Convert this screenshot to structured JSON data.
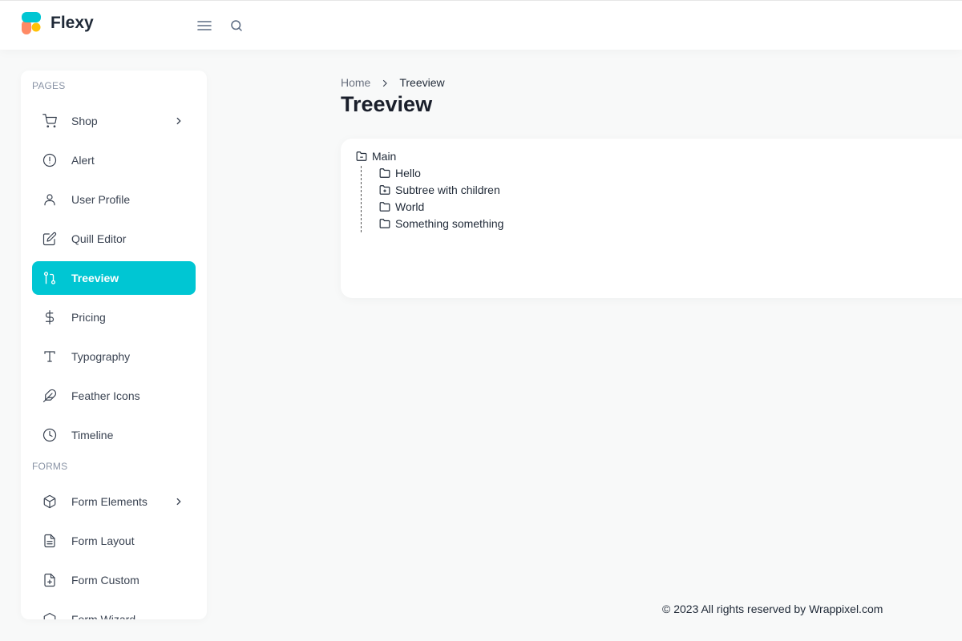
{
  "header": {
    "brand": "Flexy",
    "colors": {
      "logo_teal": "#00c6d3",
      "logo_yellow": "#ffc107",
      "logo_orange": "#ff8a65"
    },
    "menu_icon": "menu-icon",
    "search_icon": "search-icon"
  },
  "sidebar": {
    "sections": [
      {
        "label": "PAGES"
      },
      {
        "label": "FORMS"
      }
    ],
    "items": [
      {
        "label": "Shop",
        "icon": "shopping-cart-icon",
        "has_chevron": true
      },
      {
        "label": "Alert",
        "icon": "alert-circle-icon"
      },
      {
        "label": "User Profile",
        "icon": "user-icon"
      },
      {
        "label": "Quill Editor",
        "icon": "edit-icon"
      },
      {
        "label": "Treeview",
        "icon": "git-pull-request-icon",
        "active": true
      },
      {
        "label": "Pricing",
        "icon": "dollar-sign-icon"
      },
      {
        "label": "Typography",
        "icon": "type-icon"
      },
      {
        "label": "Feather Icons",
        "icon": "feather-icon"
      },
      {
        "label": "Timeline",
        "icon": "clock-icon"
      },
      {
        "label": "Form Elements",
        "icon": "box-icon",
        "has_chevron": true
      },
      {
        "label": "Form Layout",
        "icon": "file-text-icon"
      },
      {
        "label": "Form Custom",
        "icon": "file-plus-icon"
      },
      {
        "label": "Form Wizard",
        "icon": "wizard-icon"
      }
    ],
    "active_color": "#00c6d3"
  },
  "breadcrumb": {
    "home": "Home",
    "current": "Treeview"
  },
  "page": {
    "title": "Treeview"
  },
  "tree": {
    "root": "Main",
    "children": [
      "Hello",
      "Subtree with children",
      "World",
      "Something something"
    ]
  },
  "footer": {
    "text": "© 2023 All rights reserved by Wrappixel.com"
  }
}
